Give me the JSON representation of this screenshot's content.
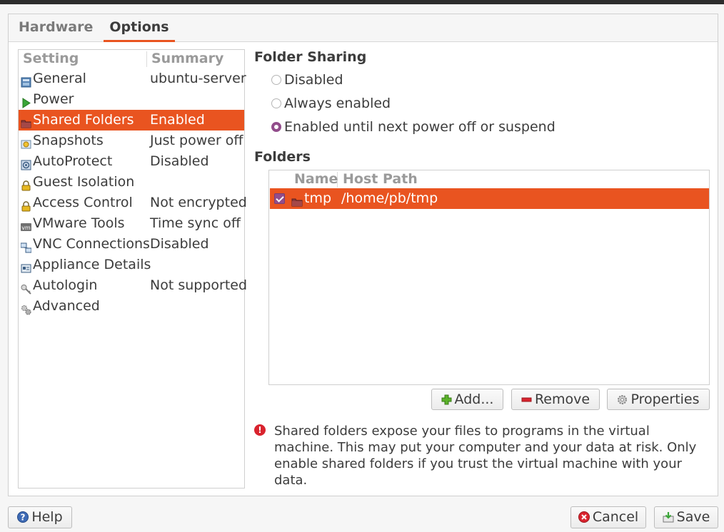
{
  "tabs": [
    {
      "label": "Hardware",
      "active": false
    },
    {
      "label": "Options",
      "active": true
    }
  ],
  "settings_list": {
    "header": {
      "setting": "Setting",
      "summary": "Summary"
    },
    "items": [
      {
        "name": "General",
        "summary": "ubuntu-server",
        "icon": "general-icon"
      },
      {
        "name": "Power",
        "summary": "",
        "icon": "play-icon"
      },
      {
        "name": "Shared Folders",
        "summary": "Enabled",
        "icon": "folder-icon",
        "selected": true
      },
      {
        "name": "Snapshots",
        "summary": "Just power off",
        "icon": "snapshot-icon"
      },
      {
        "name": "AutoProtect",
        "summary": "Disabled",
        "icon": "autoprotect-icon"
      },
      {
        "name": "Guest Isolation",
        "summary": "",
        "icon": "lock-icon"
      },
      {
        "name": "Access Control",
        "summary": "Not encrypted",
        "icon": "lock-icon"
      },
      {
        "name": "VMware Tools",
        "summary": "Time sync off",
        "icon": "vm-icon"
      },
      {
        "name": "VNC Connections",
        "summary": "Disabled",
        "icon": "network-icon"
      },
      {
        "name": "Appliance Details",
        "summary": "",
        "icon": "appliance-icon"
      },
      {
        "name": "Autologin",
        "summary": "Not supported",
        "icon": "key-icon"
      },
      {
        "name": "Advanced",
        "summary": "",
        "icon": "gears-icon"
      }
    ]
  },
  "folder_sharing": {
    "title": "Folder Sharing",
    "options": [
      {
        "label": "Disabled",
        "checked": false
      },
      {
        "label": "Always enabled",
        "checked": false
      },
      {
        "label": "Enabled until next power off or suspend",
        "checked": true
      }
    ]
  },
  "folders": {
    "title": "Folders",
    "columns": {
      "name": "Name",
      "host_path": "Host Path"
    },
    "rows": [
      {
        "enabled": true,
        "name": "tmp",
        "host_path": "/home/pb/tmp"
      }
    ]
  },
  "folder_buttons": {
    "add": "Add...",
    "remove": "Remove",
    "properties": "Properties"
  },
  "warning": {
    "text": "Shared folders expose your files to programs in the virtual machine. This may put your computer and your data at risk. Only enable shared folders if you trust the virtual machine with your data."
  },
  "footer": {
    "help": "Help",
    "cancel": "Cancel",
    "save": "Save"
  },
  "colors": {
    "accent": "#e95420",
    "radio_checked": "#924d8b",
    "error": "#d9232e"
  }
}
